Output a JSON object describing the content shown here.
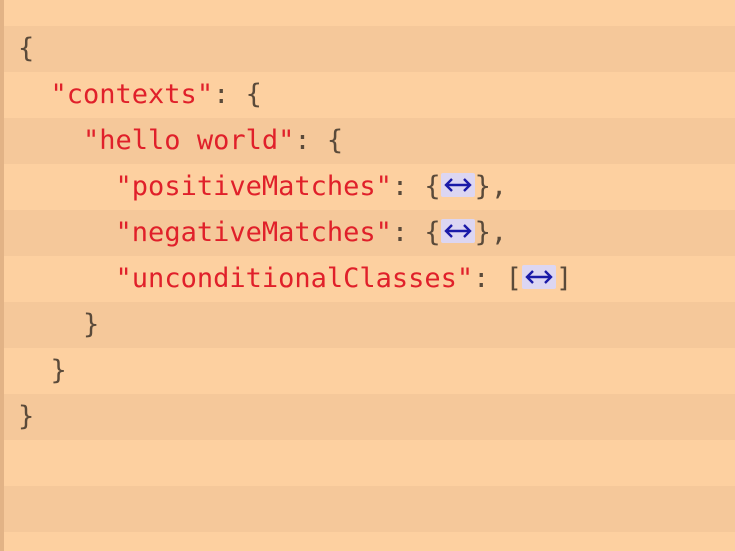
{
  "editor": {
    "lines": [
      {
        "indent": "",
        "key": "",
        "after": "{",
        "fold": false
      },
      {
        "indent": "  ",
        "key": "\"contexts\"",
        "after": ": {",
        "fold": false
      },
      {
        "indent": "    ",
        "key": "\"hello world\"",
        "after": ": {",
        "fold": false
      },
      {
        "indent": "      ",
        "key": "\"positiveMatches\"",
        "after": ": {",
        "fold": true,
        "close": "},"
      },
      {
        "indent": "      ",
        "key": "\"negativeMatches\"",
        "after": ": {",
        "fold": true,
        "close": "},"
      },
      {
        "indent": "      ",
        "key": "\"unconditionalClasses\"",
        "after": ": [",
        "fold": true,
        "close": "]"
      },
      {
        "indent": "    ",
        "key": "",
        "after": "}",
        "fold": false
      },
      {
        "indent": "  ",
        "key": "",
        "after": "}",
        "fold": false
      },
      {
        "indent": "",
        "key": "",
        "after": "}",
        "fold": false
      }
    ],
    "fold_icon": "double-arrow-icon",
    "colors": {
      "key": "#e0202a",
      "punct": "#5a4a3a",
      "fold_bg": "#dcd6f2",
      "fold_arrow": "#1a1aa8",
      "stripe_light": "#fcd4a6",
      "stripe_dark": "#f5c89a"
    }
  }
}
